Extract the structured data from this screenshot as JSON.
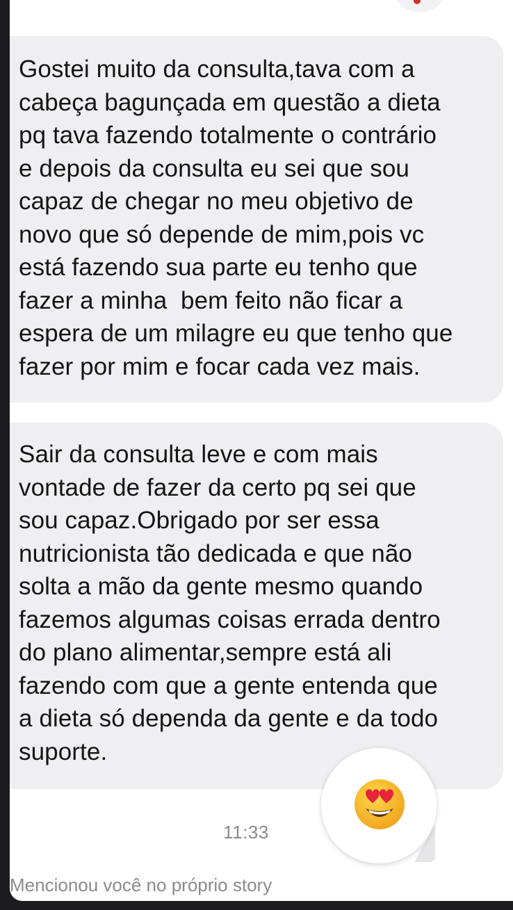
{
  "messages": [
    {
      "text": "Gostei muito da consulta,tava com a\ncabeça bagunçada em questão a dieta\npq tava fazendo totalmente o contrário\ne depois da consulta eu sei que sou\ncapaz de chegar no meu objetivo de\nnovo que só depende de mim,pois vc\nestá fazendo sua parte eu tenho que\nfazer a minha  bem feito não ficar a\nespera de um milagre eu que tenho que\nfazer por mim e focar cada vez mais."
    },
    {
      "text": "Sair da consulta leve e com mais\nvontade de fazer da certo pq sei que\nsou capaz.Obrigado por ser essa\nnutricionista tão dedicada e que não\nsolta a mão da gente mesmo quando\nfazemos algumas coisas errada dentro\ndo plano alimentar,sempre está ali\nfazendo com que a gente entenda que\na dieta só dependa da gente e da todo\nsuporte."
    }
  ],
  "reaction": {
    "icon": "heart-eyes-emoji"
  },
  "timestamp": "11:33",
  "story_mention": "Mencionou você no próprio story",
  "colors": {
    "bubble": "#efeff1",
    "text": "#141414",
    "meta_text": "#8a8a8e",
    "background": "#ffffff",
    "frame": "#1c1c1e"
  }
}
